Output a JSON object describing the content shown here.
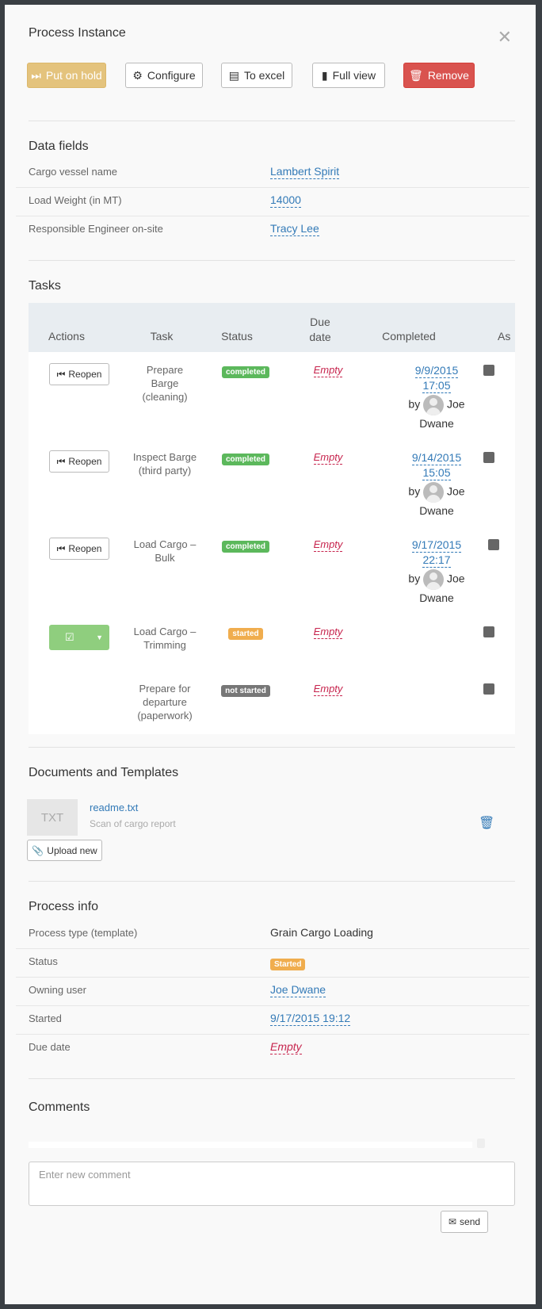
{
  "header": {
    "title": "Process Instance",
    "buttons": {
      "hold": "Put on hold",
      "configure": "Configure",
      "excel": "To excel",
      "fullview": "Full view",
      "remove": "Remove"
    }
  },
  "data_fields": {
    "title": "Data fields",
    "rows": [
      {
        "label": "Cargo vessel name",
        "value": "Lambert Spirit"
      },
      {
        "label": "Load Weight (in MT)",
        "value": "14000"
      },
      {
        "label": "Responsible Engineer on-site",
        "value": "Tracy Lee"
      }
    ]
  },
  "tasks": {
    "title": "Tasks",
    "columns": [
      "Actions",
      "Task",
      "Status",
      "Due date",
      "Completed",
      "As"
    ],
    "rows": [
      {
        "action": "Reopen",
        "task": "Prepare Barge (cleaning)",
        "status": "completed",
        "due": "Empty",
        "completed_date": "9/9/2015",
        "completed_time": "17:05",
        "by": "by",
        "user_first": "Joe",
        "user_last": "Dwane"
      },
      {
        "action": "Reopen",
        "task": "Inspect Barge (third party)",
        "status": "completed",
        "due": "Empty",
        "completed_date": "9/14/2015",
        "completed_time": "15:05",
        "by": "by",
        "user_first": "Joe",
        "user_last": "Dwane"
      },
      {
        "action": "Reopen",
        "task": "Load Cargo – Bulk",
        "status": "completed",
        "due": "Empty",
        "completed_date": "9/17/2015",
        "completed_time": "22:17",
        "by": "by",
        "user_first": "Joe",
        "user_last": "Dwane"
      },
      {
        "action": "",
        "task": "Load Cargo – Trimming",
        "status": "started",
        "due": "Empty"
      },
      {
        "action": "",
        "task": "Prepare for departure (paperwork)",
        "status": "not started",
        "due": "Empty"
      }
    ]
  },
  "documents": {
    "title": "Documents and Templates",
    "file_type": "TXT",
    "file_name": "readme.txt",
    "file_desc": "Scan of cargo report",
    "upload": "Upload new"
  },
  "process_info": {
    "title": "Process info",
    "rows": [
      {
        "label": "Process type (template)",
        "value": "Grain Cargo Loading"
      },
      {
        "label": "Status",
        "value": "Started"
      },
      {
        "label": "Owning user",
        "value": "Joe Dwane"
      },
      {
        "label": "Started",
        "value": "9/17/2015 19:12"
      },
      {
        "label": "Due date",
        "value": "Empty"
      }
    ]
  },
  "comments": {
    "title": "Comments",
    "placeholder": "Enter new comment",
    "send": "send"
  },
  "colors": {
    "warning": "#e4c37d",
    "danger": "#d9534f",
    "success": "#5cb85c",
    "started": "#f0ad4e",
    "link": "#337ab7"
  }
}
